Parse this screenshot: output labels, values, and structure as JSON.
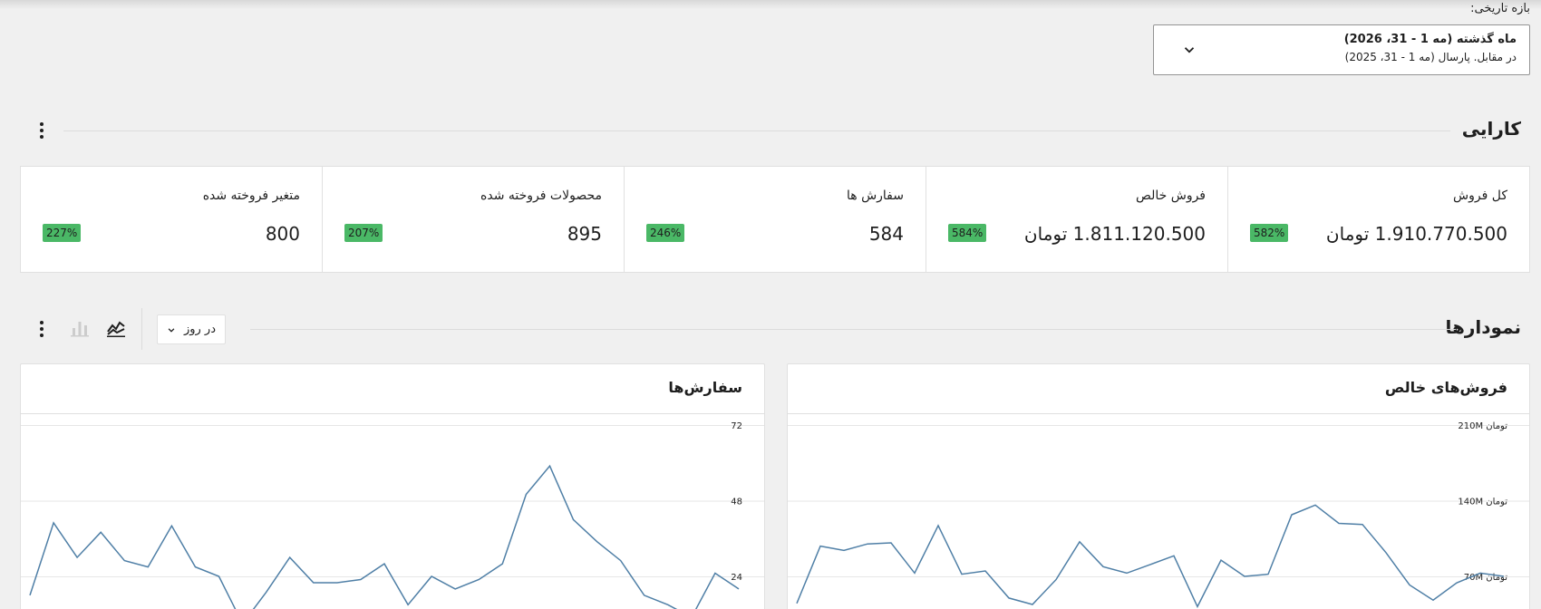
{
  "date_range": {
    "label": "بازه تاریخی:",
    "primary": "ماه گذشته (مه 1 - 31، 2026)",
    "secondary": "در مقابل. پارسال (مه 1 - 31، 2025)"
  },
  "performance": {
    "title": "کارایی",
    "kpis": [
      {
        "label": "کل فروش",
        "value": "1.910.770.500 تومان",
        "delta": "582%"
      },
      {
        "label": "فروش خالص",
        "value": "1.811.120.500 تومان",
        "delta": "584%"
      },
      {
        "label": "سفارش ها",
        "value": "584",
        "delta": "246%"
      },
      {
        "label": "محصولات فروخته شده",
        "value": "895",
        "delta": "207%"
      },
      {
        "label": "متغیر فروخته شده",
        "value": "800",
        "delta": "227%"
      }
    ]
  },
  "charts_section": {
    "title": "نمودارها",
    "interval": "در روز"
  },
  "colors": {
    "line": "#4f7fa6",
    "badge": "#4ab866",
    "grid": "#e6e6e6"
  },
  "chart_data": [
    {
      "type": "line",
      "title": "فروش‌های خالص",
      "y_ticks": [
        "210M تومان",
        "140M تومان",
        "70M تومان"
      ],
      "ylim": [
        0,
        210
      ],
      "tick_values": [
        210,
        140,
        70
      ],
      "x": [
        1,
        2,
        3,
        4,
        5,
        6,
        7,
        8,
        9,
        10,
        11,
        12,
        13,
        14,
        15,
        16,
        17,
        18,
        19,
        20,
        21,
        22,
        23,
        24,
        25,
        26,
        27,
        28,
        29,
        30,
        31
      ],
      "values": [
        45,
        98,
        94,
        100,
        101,
        73,
        117,
        72,
        75,
        50,
        44,
        67,
        102,
        79,
        73,
        81,
        89,
        42,
        85,
        70,
        72,
        127,
        136,
        119,
        118,
        92,
        62,
        48,
        64,
        73,
        70
      ]
    },
    {
      "type": "line",
      "title": "سفارش‌ها",
      "y_ticks": [
        "72",
        "48",
        "24"
      ],
      "ylim": [
        0,
        72
      ],
      "tick_values": [
        72,
        48,
        24
      ],
      "x": [
        1,
        2,
        3,
        4,
        5,
        6,
        7,
        8,
        9,
        10,
        11,
        12,
        13,
        14,
        15,
        16,
        17,
        18,
        19,
        20,
        21,
        22,
        23,
        24,
        25,
        26,
        27,
        28,
        29,
        30,
        31
      ],
      "values": [
        18,
        41,
        30,
        38,
        29,
        27,
        40,
        27,
        24,
        9,
        19,
        30,
        22,
        22,
        23,
        28,
        15,
        24,
        20,
        23,
        28,
        50,
        59,
        42,
        35,
        29,
        18,
        15,
        11,
        25,
        20
      ]
    }
  ]
}
